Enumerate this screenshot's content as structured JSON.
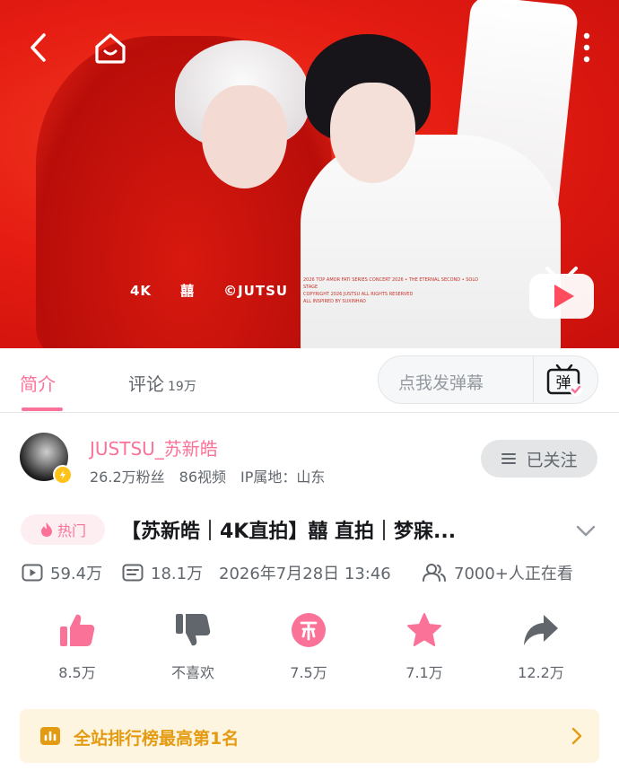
{
  "video": {
    "overlay_labels": [
      "4K",
      "囍",
      "©JUTSU"
    ],
    "overlay_fine_print": [
      "2026 TOP AMOR FATI SERIES CONCERT 2026 • THE ETERNAL SECOND • SOLO STAGE",
      "COPYRIGHT 2026 JUSTSU ALL RIGHTS RESERVED",
      "ALL INSPIRED BY SUXINHAO"
    ],
    "icons": [
      "back-arrow-icon",
      "home-tv-icon",
      "more-vertical-icon",
      "play-badge-icon"
    ]
  },
  "tabs": {
    "intro_label": "简介",
    "comments_label": "评论",
    "comments_count": "19万",
    "danmaku_placeholder": "点我发弹幕",
    "danmaku_icon_label": "弹"
  },
  "uploader": {
    "name": "JUSTSU_苏新皓",
    "fans": "26.2万粉丝",
    "videos": "86视频",
    "ip_location": "IP属地：山东",
    "follow_label": "已关注"
  },
  "title": {
    "hot_label": "热门",
    "text": "【苏新皓｜4K直拍】囍 直拍｜梦寐..."
  },
  "stats": {
    "plays": "59.4万",
    "danmaku": "18.1万",
    "publish_time": "2026年7月28日 13:46",
    "watching": "7000+人正在看"
  },
  "actions": {
    "like": "8.5万",
    "dislike": "不喜欢",
    "coin": "7.5万",
    "favorite": "7.1万",
    "share": "12.2万"
  },
  "ranking": {
    "text": "全站排行榜最高第1名"
  },
  "colors": {
    "accent_pink": "#fb7299",
    "rank_text": "#e49b12",
    "rank_bg": "#fdf5df",
    "video_red": "#e51c12"
  }
}
